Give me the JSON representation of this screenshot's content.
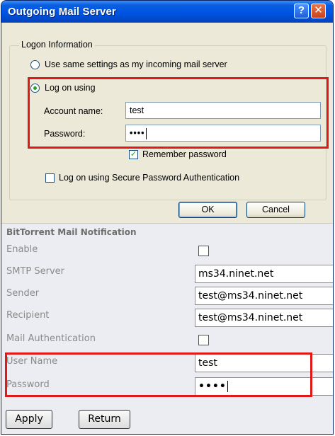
{
  "window": {
    "title": "Outgoing Mail Server",
    "help_glyph": "?",
    "close_glyph": "✕"
  },
  "logon": {
    "group_label": "Logon Information",
    "same_settings_label": "Use same settings as my incoming mail server",
    "log_on_using_label": "Log on using",
    "selected_option": "Log on using",
    "account_name_label": "Account name:",
    "account_name_value": "test",
    "password_label": "Password:",
    "password_value": "••••",
    "remember_password_label": "Remember password",
    "remember_password_checked": true,
    "spa_label": "Log on using Secure Password Authentication",
    "spa_checked": false,
    "ok_label": "OK",
    "cancel_label": "Cancel"
  },
  "notification": {
    "title": "BitTorrent Mail Notification",
    "enable_label": "Enable",
    "enable_checked": false,
    "smtp_server_label": "SMTP Server",
    "smtp_server_value": "ms34.ninet.net",
    "sender_label": "Sender",
    "sender_value": "test@ms34.ninet.net",
    "recipient_label": "Recipient",
    "recipient_value": "test@ms34.ninet.net",
    "mail_auth_label": "Mail Authentication",
    "mail_auth_checked": false,
    "user_name_label": "User Name",
    "user_name_value": "test",
    "password_label": "Password",
    "password_value": "••••",
    "apply_label": "Apply",
    "return_label": "Return"
  },
  "colors": {
    "titlebar": "#0054e3",
    "highlight_box": "#e01818",
    "dialog_bg": "#ece9d8",
    "panel_bg": "#ecedf2"
  }
}
